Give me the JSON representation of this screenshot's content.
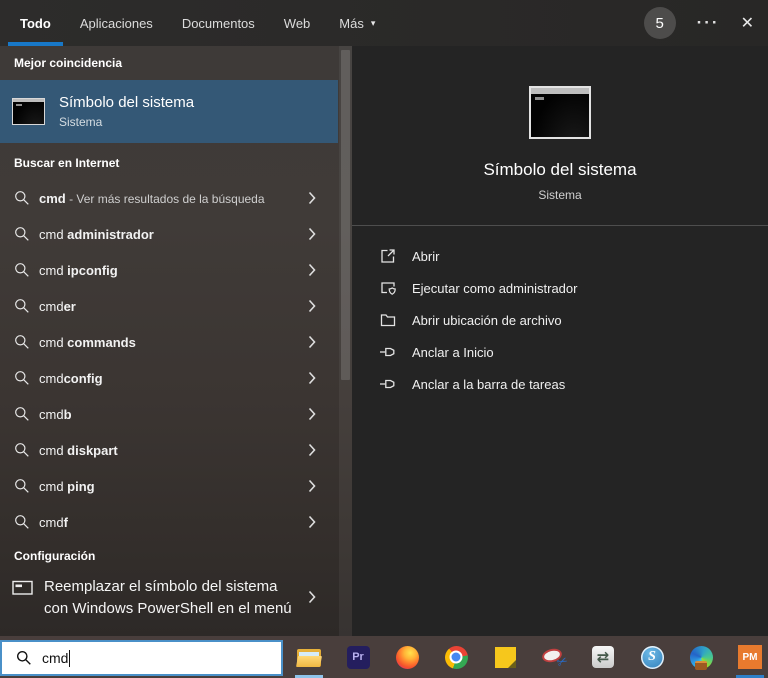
{
  "topbar": {
    "tabs": [
      {
        "label": "Todo",
        "active": true
      },
      {
        "label": "Aplicaciones",
        "active": false
      },
      {
        "label": "Documentos",
        "active": false
      },
      {
        "label": "Web",
        "active": false
      },
      {
        "label": "Más",
        "active": false,
        "dropdown": true
      }
    ],
    "badge_count": "5",
    "ellipsis_glyph": "···",
    "close_glyph": "✕",
    "dropdown_arrow_glyph": "▾"
  },
  "left_panel": {
    "best_match_header": "Mejor coincidencia",
    "best_match": {
      "title": "Símbolo del sistema",
      "subtitle": "Sistema",
      "icon": "cmd-terminal-icon"
    },
    "search_header": "Buscar en Internet",
    "suggestions": [
      {
        "pre": "cmd",
        "pre_bold": true,
        "post": " - Ver más resultados de la búsqueda",
        "post_dim": true
      },
      {
        "pre": "cmd ",
        "post": "administrador",
        "post_bold": true
      },
      {
        "pre": "cmd ",
        "post": "ipconfig",
        "post_bold": true
      },
      {
        "pre": "cmd",
        "post": "er",
        "post_bold": true
      },
      {
        "pre": "cmd ",
        "post": "commands",
        "post_bold": true
      },
      {
        "pre": "cmd",
        "post": "config",
        "post_bold": true
      },
      {
        "pre": "cmd",
        "post": "b",
        "post_bold": true
      },
      {
        "pre": "cmd ",
        "post": "diskpart",
        "post_bold": true
      },
      {
        "pre": "cmd ",
        "post": "ping",
        "post_bold": true
      },
      {
        "pre": "cmd",
        "post": "f",
        "post_bold": true
      }
    ],
    "settings_header": "Configuración",
    "settings_item": {
      "line1": "Reemplazar el símbolo del sistema",
      "line2": "con Windows PowerShell en el menú",
      "icon": "console-window-icon"
    }
  },
  "right_panel": {
    "title": "Símbolo del sistema",
    "subtitle": "Sistema",
    "icon": "cmd-terminal-icon-large",
    "actions": [
      {
        "label": "Abrir",
        "icon": "open-icon"
      },
      {
        "label": "Ejecutar como administrador",
        "icon": "run-as-admin-icon"
      },
      {
        "label": "Abrir ubicación de archivo",
        "icon": "file-location-icon"
      },
      {
        "label": "Anclar a Inicio",
        "icon": "pin-icon"
      },
      {
        "label": "Anclar a la barra de tareas",
        "icon": "pin-icon"
      }
    ]
  },
  "search_bar": {
    "value": "cmd",
    "icon": "search-icon"
  },
  "taskbar": {
    "icons": [
      {
        "name": "file-explorer",
        "running": true,
        "indicator": "light"
      },
      {
        "name": "premiere",
        "label": "Pr"
      },
      {
        "name": "firefox"
      },
      {
        "name": "chrome"
      },
      {
        "name": "sticky-notes"
      },
      {
        "name": "disc-scissors-app",
        "glyph": "✂"
      },
      {
        "name": "file-transfer-app",
        "glyph": "⇄"
      },
      {
        "name": "s-app",
        "label": "S"
      },
      {
        "name": "edge-work-profile"
      },
      {
        "name": "pm-app",
        "label": "PM",
        "running": true,
        "indicator": "blue"
      }
    ]
  },
  "colors": {
    "accent_blue": "#1878c8",
    "best_match_highlight": "#345876",
    "search_box_border": "#4a90c8",
    "right_panel_bg": "#242424",
    "taskbar_bg": "#493e3c",
    "running_indicator_blue": "#2e7fc9",
    "explorer_indicator_blue": "#8fc3ea",
    "pm_app_orange": "#e87a2e"
  }
}
